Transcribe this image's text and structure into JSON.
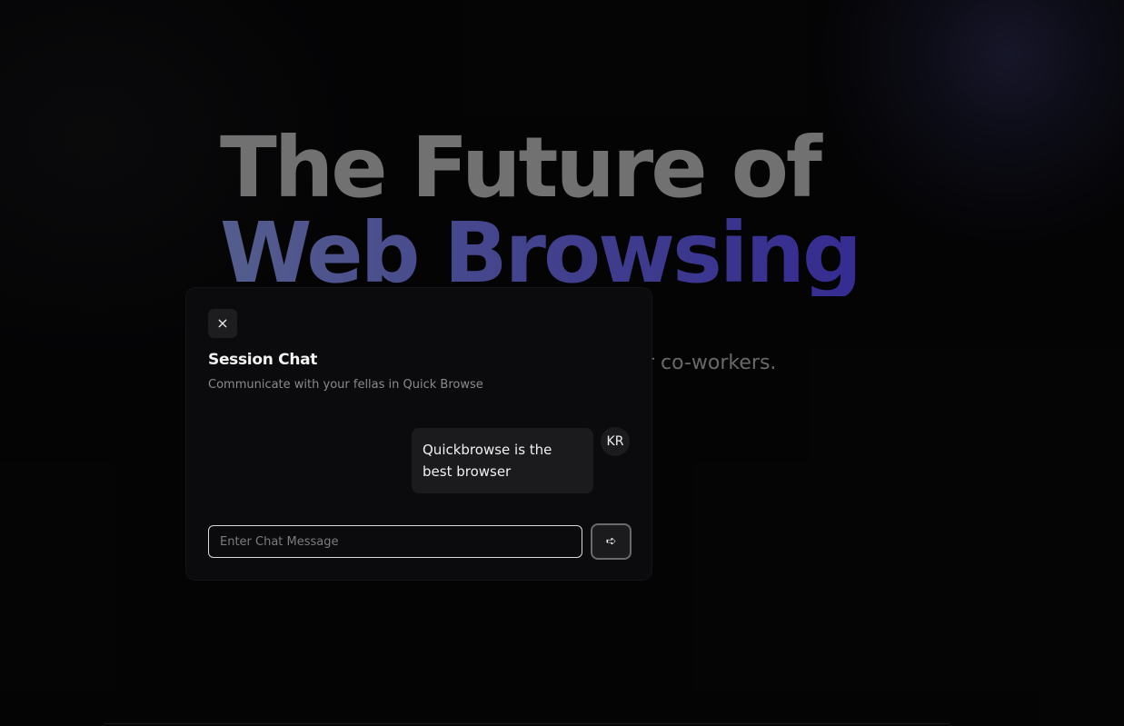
{
  "hero": {
    "title_line1": "The Future of",
    "title_line2": "Web Browsing",
    "description": "A collaborative web browser with friends or co-workers. Browse together."
  },
  "chat": {
    "close_icon": "×",
    "title": "Session Chat",
    "subtitle": "Communicate with your fellas in Quick Browse",
    "messages": [
      {
        "text": "Quickbrowse is the best browser",
        "avatar_initials": "KR"
      }
    ],
    "input_placeholder": "Enter Chat Message",
    "input_value": "",
    "send_icon": "➪"
  },
  "colors": {
    "background": "#050506",
    "title_gray": "#7b7b7b",
    "title_gradient_start": "#5c6699",
    "title_gradient_end": "#3a2f9e",
    "dialog_bg": "#0b0b0d"
  }
}
